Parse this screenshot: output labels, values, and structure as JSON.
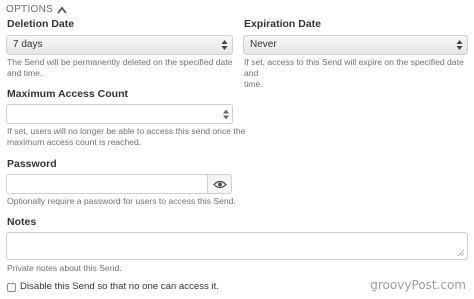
{
  "options": {
    "header": "OPTIONS"
  },
  "deletion": {
    "label": "Deletion Date",
    "value": "7 days",
    "hint_line1": "The Send will be permanently deleted on the specified date",
    "hint_line2": "and time."
  },
  "expiration": {
    "label": "Expiration Date",
    "value": "Never",
    "hint_line1": "If set, access to this Send will expire on the specified date and",
    "hint_line2": "time."
  },
  "max_access": {
    "label": "Maximum Access Count",
    "value": "",
    "hint_line1": "If set, users will no longer be able to access this send once the",
    "hint_line2": "maximum access count is reached."
  },
  "password": {
    "label": "Password",
    "value": "",
    "hint": "Optionally require a password for users to access this Send."
  },
  "notes": {
    "label": "Notes",
    "value": "",
    "hint": "Private notes about this Send."
  },
  "disable": {
    "label": "Disable this Send so that no one can access it.",
    "checked": false
  },
  "watermark": "groovyPost.com"
}
